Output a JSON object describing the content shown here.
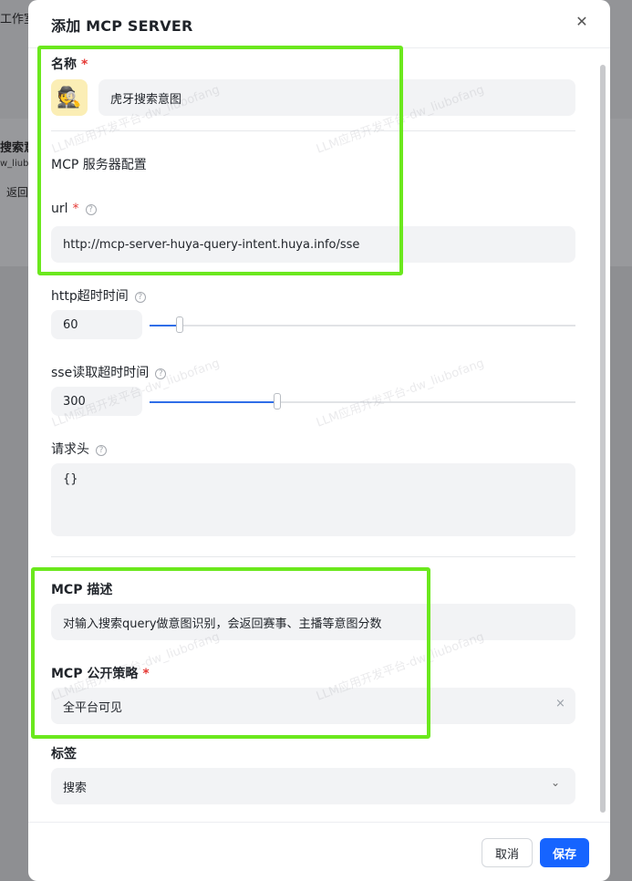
{
  "background": {
    "breadcrumb_fragment": "工作室",
    "card_title_fragment": "搜索意",
    "card_owner_fragment": "w_liubo",
    "back_fragment": "返回"
  },
  "modal": {
    "title": "添加 MCP SERVER",
    "close_icon": "close-icon",
    "name": {
      "label": "名称",
      "required_mark": "*",
      "avatar_emoji": "🕵️",
      "value": "虎牙搜索意图"
    },
    "server_config": {
      "section_title": "MCP 服务器配置",
      "url": {
        "label": "url",
        "required_mark": "*",
        "help_glyph": "?",
        "value": "http://mcp-server-huya-query-intent.huya.info/sse"
      },
      "http_timeout": {
        "label": "http超时时间",
        "help_glyph": "?",
        "value": "60",
        "slider_fraction": 0.07
      },
      "sse_timeout": {
        "label": "sse读取超时时间",
        "help_glyph": "?",
        "value": "300",
        "slider_fraction": 0.3
      },
      "headers": {
        "label": "请求头",
        "help_glyph": "?",
        "value": "{}"
      }
    },
    "description": {
      "label": "MCP 描述",
      "value": "对输入搜索query做意图识别，会返回赛事、主播等意图分数"
    },
    "policy": {
      "label": "MCP 公开策略",
      "required_mark": "*",
      "value": "全平台可见",
      "clear_glyph": "×"
    },
    "tags": {
      "label": "标签",
      "value": "搜索",
      "chevron_glyph": "⌄"
    },
    "footer": {
      "cancel_label": "取消",
      "save_label": "保存"
    },
    "watermark_text": "LLM应用开发平台-dw_liubofang",
    "highlight_color": "#6be81d",
    "primary_color": "#1664ff"
  }
}
